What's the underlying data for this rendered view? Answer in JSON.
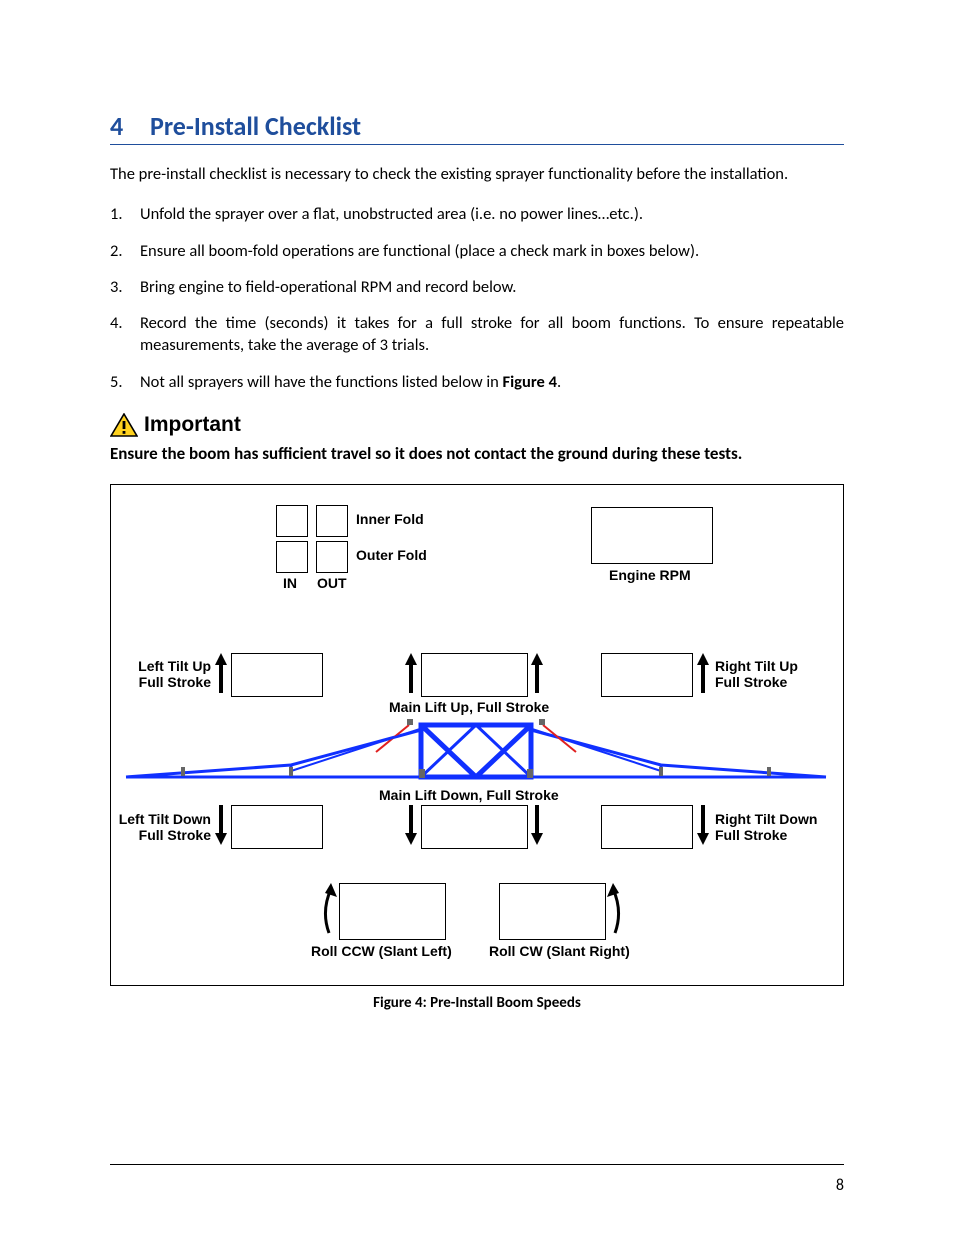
{
  "heading": {
    "number": "4",
    "title": "Pre-Install Checklist"
  },
  "intro": "The pre-install checklist is necessary to check the existing sprayer functionality before the installation.",
  "steps": [
    "Unfold the sprayer over a flat, unobstructed area (i.e. no power lines…etc.).",
    "Ensure all boom-fold operations are functional (place a check mark in boxes below).",
    "Bring engine to field-operational RPM and record below.",
    "Record the time (seconds) it takes for a full stroke for all boom functions.  To ensure repeatable measurements, take the average of 3 trials."
  ],
  "step5_prefix": "Not all sprayers will have the functions listed below in ",
  "step5_figref": "Figure 4",
  "step5_suffix": ".",
  "important": {
    "label": "Important",
    "text": "Ensure the boom has sufficient travel so it does not contact the ground during these tests."
  },
  "figure": {
    "caption": "Figure 4: Pre-Install Boom Speeds",
    "labels": {
      "inner_fold": "Inner Fold",
      "outer_fold": "Outer Fold",
      "in": "IN",
      "out": "OUT",
      "engine_rpm": "Engine RPM",
      "left_tilt_up": "Left Tilt Up",
      "left_tilt_up_fs": "Full Stroke",
      "right_tilt_up": "Right Tilt Up",
      "right_tilt_up_fs": "Full Stroke",
      "main_lift_up": "Main Lift Up, Full Stroke",
      "main_lift_down": "Main Lift Down, Full Stroke",
      "left_tilt_down": "Left Tilt Down",
      "left_tilt_down_fs": "Full Stroke",
      "right_tilt_down": "Right Tilt  Down",
      "right_tilt_down_fs": "Full Stroke",
      "roll_ccw": "Roll CCW (Slant Left)",
      "roll_cw": "Roll CW (Slant Right)"
    }
  },
  "page_number": "8"
}
